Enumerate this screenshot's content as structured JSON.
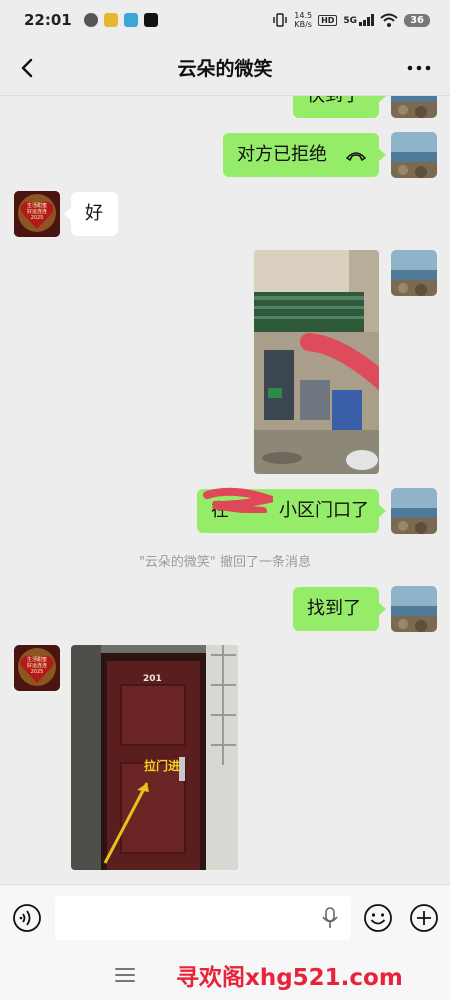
{
  "status_bar": {
    "time": "22:01",
    "net_speed_value": "14.5",
    "net_speed_unit": "KB/s",
    "hd": "HD",
    "network": "5G",
    "battery": "36"
  },
  "header": {
    "title": "云朵的微笑"
  },
  "messages": {
    "m1": "快到了",
    "m2": "对方已拒绝",
    "m3": "好",
    "m5": "在",
    "m5_tail": "小区门口了",
    "recall_notice": "\"云朵的微笑\" 撤回了一条消息",
    "m6": "找到了"
  },
  "avatar_text": {
    "line1": "生活甜蜜",
    "line2": "好运连连",
    "line3": "2025"
  },
  "door_photo": {
    "number": "201",
    "annotation": "拉门进"
  },
  "watermark": "寻欢阁xhg521.com"
}
